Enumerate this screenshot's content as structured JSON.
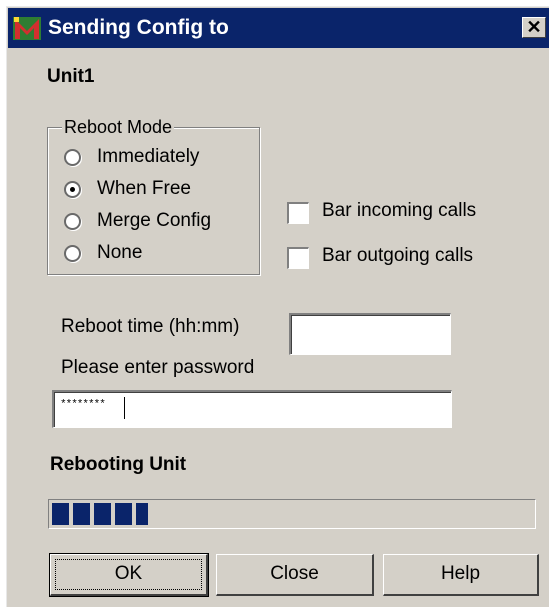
{
  "window": {
    "title": "Sending Config to",
    "icon": "app-icon",
    "close_glyph": "✕"
  },
  "unit": "Unit1",
  "reboot_mode": {
    "legend": "Reboot Mode",
    "options": [
      "Immediately",
      "When Free",
      "Merge Config",
      "None"
    ],
    "selected": "When Free"
  },
  "options": {
    "bar_incoming": {
      "label": "Bar incoming calls",
      "checked": false
    },
    "bar_outgoing": {
      "label": "Bar outgoing calls",
      "checked": false
    }
  },
  "reboot_time": {
    "label": "Reboot time (hh:mm)",
    "value": ""
  },
  "password": {
    "label": "Please enter password",
    "value": "********"
  },
  "status": {
    "text": "Rebooting Unit",
    "progress": 0.2
  },
  "buttons": {
    "ok": "OK",
    "close": "Close",
    "help": "Help"
  },
  "colors": {
    "titlebar": "#0a246a",
    "face": "#d4d0c8",
    "progress": "#0a246a"
  }
}
